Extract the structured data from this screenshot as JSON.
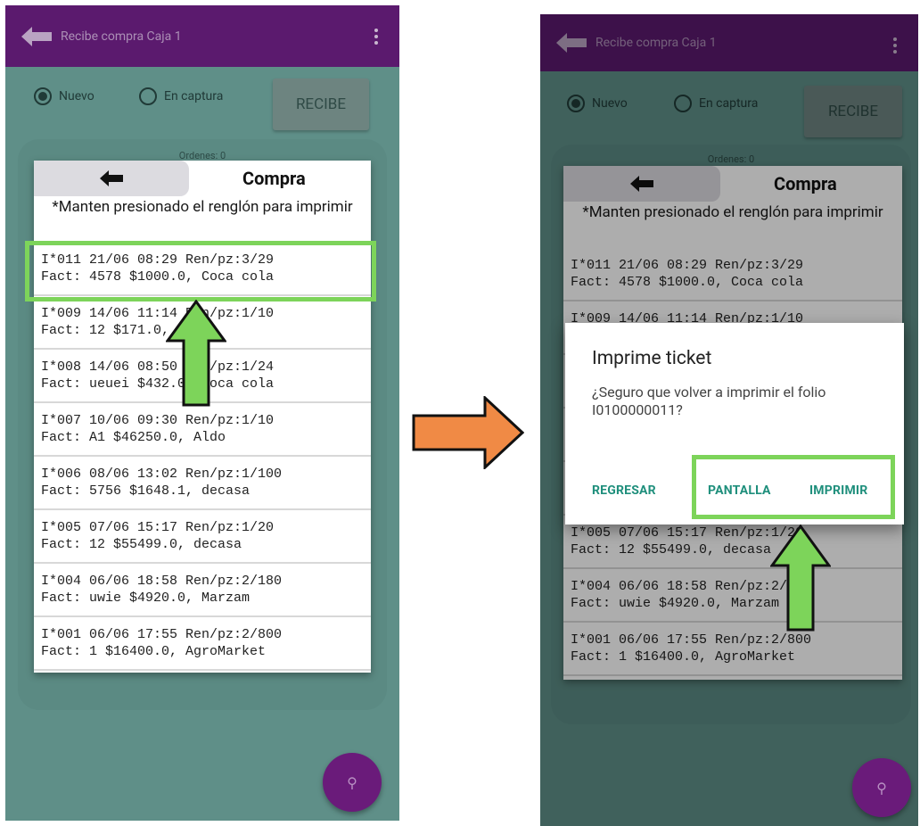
{
  "app": {
    "title": "Recibe compra Caja 1"
  },
  "toolbar": {
    "radio_nuevo": "Nuevo",
    "radio_en_captura": "En captura",
    "recibe_button": "RECIBE",
    "ordenes_label": "Ordenes: 0"
  },
  "sheet": {
    "title": "Compra",
    "instruction": "*Manten presionado el renglón para imprimir"
  },
  "rows": [
    {
      "line1": "I*011 21/06 08:29 Ren/pz:3/29",
      "line2": "Fact: 4578 $1000.0, Coca cola"
    },
    {
      "line1": "I*009 14/06 11:14 Ren/pz:1/10",
      "line2": "Fact: 12 $171.0, Aldo"
    },
    {
      "line1": "I*008 14/06 08:50 Ren/pz:1/24",
      "line2": "Fact: ueuei $432.0, Coca cola"
    },
    {
      "line1": "I*007 10/06 09:30 Ren/pz:1/10",
      "line2": "Fact: A1 $46250.0, Aldo"
    },
    {
      "line1": "I*006 08/06 13:02 Ren/pz:1/100",
      "line2": "Fact: 5756 $1648.1, decasa"
    },
    {
      "line1": "I*005 07/06 15:17 Ren/pz:1/20",
      "line2": "Fact: 12 $55499.0, decasa"
    },
    {
      "line1": "I*004 06/06 18:58 Ren/pz:2/180",
      "line2": "Fact: uwie $4920.0, Marzam"
    },
    {
      "line1": "I*001 06/06 17:55 Ren/pz:2/800",
      "line2": "Fact: 1 $16400.0, AgroMarket"
    }
  ],
  "dialog": {
    "title": "Imprime ticket",
    "message": "¿Seguro que volver a imprimir el folio I0100000011?",
    "btn_regresar": "REGRESAR",
    "btn_pantalla": "PANTALLA",
    "btn_imprimir": "IMPRIMIR"
  },
  "colors": {
    "appbar": "#5b1a6e",
    "background": "#5f8f88",
    "highlight": "#7dd45a",
    "arrow_orange": "#f08a45",
    "dialog_button": "#1f8f7c"
  },
  "icons": [
    "back-arrow-icon",
    "more-vert-icon",
    "search-icon",
    "up-arrow-icon",
    "right-arrow-icon"
  ]
}
